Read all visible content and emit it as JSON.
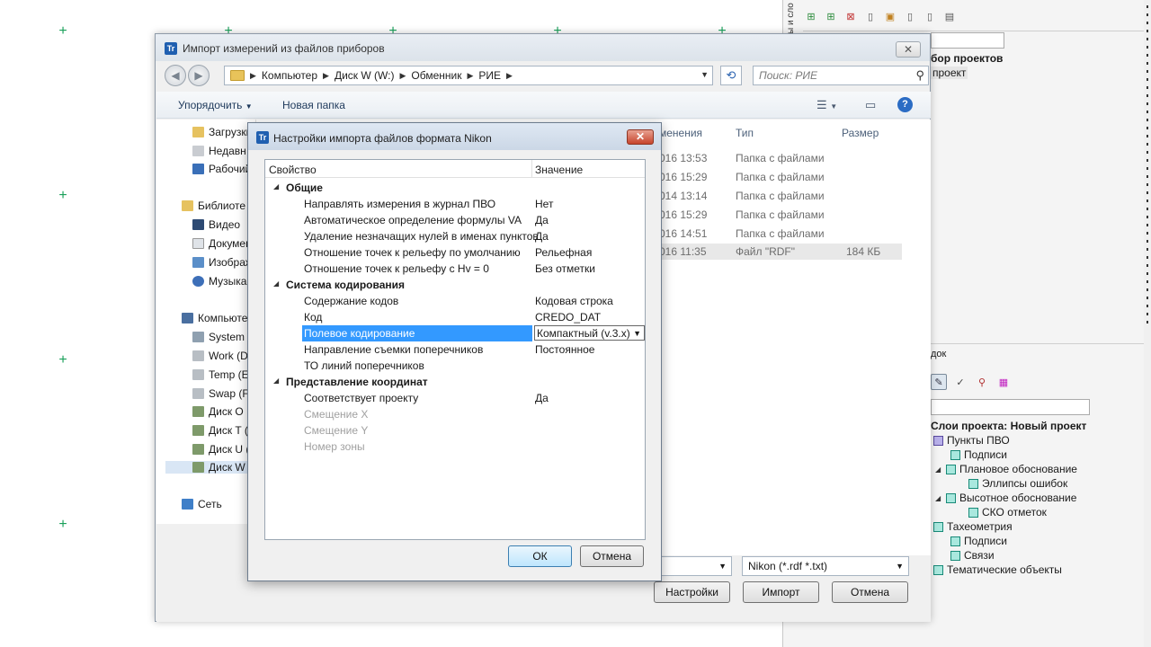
{
  "background": {
    "right_panel": {
      "vertical_text": "ы и сло",
      "filter_input_value": "",
      "project_header": "бор проектов",
      "project_item": "проект",
      "lower_tab": "док",
      "layers_filter_value": "",
      "layers_title": "Слои проекта: Новый проект",
      "layers": [
        {
          "label": "Пункты ПВО"
        },
        {
          "label": "Подписи"
        },
        {
          "label": "Плановое обоснование"
        },
        {
          "label": "Эллипсы ошибок"
        },
        {
          "label": "Высотное обоснование"
        },
        {
          "label": "СКО отметок"
        },
        {
          "label": "Тахеометрия"
        },
        {
          "label": "Подписи"
        },
        {
          "label": "Связи"
        },
        {
          "label": "Тематические объекты"
        }
      ]
    }
  },
  "file_dialog": {
    "title": "Импорт измерений из файлов приборов",
    "app_icon": "Tr",
    "breadcrumb": [
      "Компьютер",
      "Диск W (W:)",
      "Обменник",
      "РИЕ"
    ],
    "search_placeholder": "Поиск: РИЕ",
    "organize_label": "Упорядочить",
    "new_folder_label": "Новая папка",
    "nav_items": [
      "Загрузки",
      "Недавн",
      "Рабочий",
      "Библиоте",
      "Видео",
      "Докумен",
      "Изображ",
      "Музыка",
      "Компьюте",
      "System (",
      "Work (D",
      "Temp (E",
      "Swap (F:",
      "Диск O",
      "Диск T (",
      "Диск U (",
      "Диск W",
      "Сеть"
    ],
    "columns": {
      "modified": "менения",
      "type": "Тип",
      "size": "Размер"
    },
    "files": [
      {
        "modified": "016 13:53",
        "type": "Папка с файлами",
        "size": ""
      },
      {
        "modified": "016 15:29",
        "type": "Папка с файлами",
        "size": ""
      },
      {
        "modified": "014 13:14",
        "type": "Папка с файлами",
        "size": ""
      },
      {
        "modified": "016 15:29",
        "type": "Папка с файлами",
        "size": ""
      },
      {
        "modified": "016 14:51",
        "type": "Папка с файлами",
        "size": ""
      },
      {
        "modified": "016 11:35",
        "type": "Файл \"RDF\"",
        "size": "184 КБ"
      }
    ],
    "filename_value": "",
    "filter_value": "Nikon (*.rdf *.txt)",
    "settings_button": "Настройки",
    "import_button": "Импорт",
    "cancel_button": "Отмена"
  },
  "modal": {
    "title": "Настройки импорта файлов формата Nikon",
    "app_icon": "Tr",
    "close_glyph": "✕",
    "col_property": "Свойство",
    "col_value": "Значение",
    "groups": [
      {
        "name": "Общие",
        "rows": [
          {
            "name": "Направлять измерения в журнал ПВО",
            "value": "Нет"
          },
          {
            "name": "Автоматическое определение формулы VA",
            "value": "Да"
          },
          {
            "name": "Удаление незначащих нулей в именах пунктов",
            "value": "Да"
          },
          {
            "name": "Отношение точек к рельефу по умолчанию",
            "value": "Рельефная"
          },
          {
            "name": "Отношение точек к рельефу с Hv = 0",
            "value": "Без отметки"
          }
        ]
      },
      {
        "name": "Система кодирования",
        "rows": [
          {
            "name": "Содержание кодов",
            "value": "Кодовая строка"
          },
          {
            "name": "Код",
            "value": "CREDO_DAT"
          },
          {
            "name": "Полевое кодирование",
            "value": "Компактный (v.3.x)"
          },
          {
            "name": "Направление съемки поперечников",
            "value": "Постоянное"
          },
          {
            "name": "ТО линий поперечников",
            "value": ""
          }
        ]
      },
      {
        "name": "Представление координат",
        "rows": [
          {
            "name": "Соответствует проекту",
            "value": "Да"
          },
          {
            "name": "Смещение X",
            "value": ""
          },
          {
            "name": "Смещение Y",
            "value": ""
          },
          {
            "name": "Номер зоны",
            "value": ""
          }
        ]
      }
    ],
    "ok_button": "ОК",
    "cancel_button": "Отмена"
  }
}
